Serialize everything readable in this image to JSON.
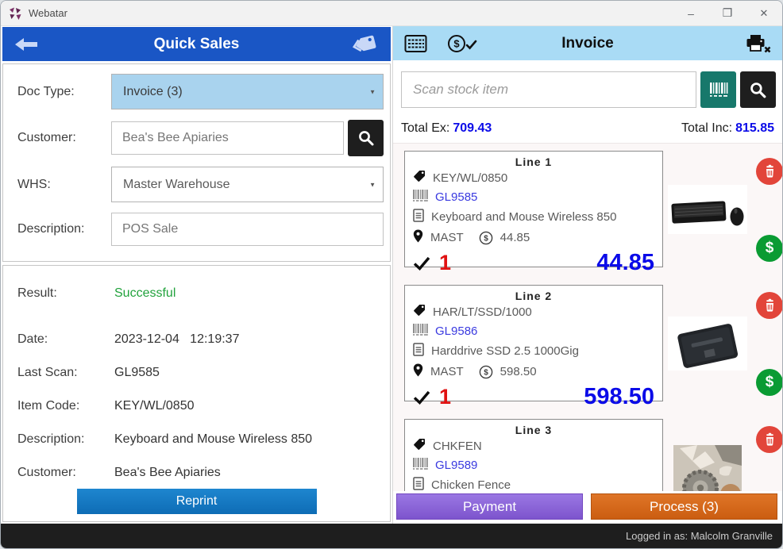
{
  "window": {
    "title": "Webatar",
    "controls": {
      "minimize": "–",
      "maximize": "❒",
      "close": "✕"
    }
  },
  "left_panel": {
    "header": {
      "title": "Quick Sales"
    },
    "form": {
      "doc_type": {
        "label": "Doc Type:",
        "value": "Invoice (3)"
      },
      "customer": {
        "label": "Customer:",
        "value": "Bea's Bee Apiaries"
      },
      "whs": {
        "label": "WHS:",
        "value": "Master Warehouse"
      },
      "description": {
        "label": "Description:",
        "value": "POS Sale"
      }
    },
    "result": {
      "rows": [
        {
          "label": "Result:",
          "value": "Successful"
        },
        {
          "label": "Date:",
          "value": "2023-12-04   12:19:37"
        },
        {
          "label": "Last Scan:",
          "value": "GL9585"
        },
        {
          "label": "Item Code:",
          "value": "KEY/WL/0850"
        },
        {
          "label": "Description:",
          "value": "Keyboard and Mouse Wireless 850"
        },
        {
          "label": "Customer:",
          "value": "Bea's Bee Apiaries"
        }
      ],
      "reprint_label": "Reprint"
    }
  },
  "right_panel": {
    "header": {
      "title": "Invoice"
    },
    "scan": {
      "placeholder": "Scan stock item"
    },
    "totals": {
      "ex_label": "Total Ex:",
      "ex_value": "709.43",
      "inc_label": "Total Inc:",
      "inc_value": "815.85"
    },
    "lines": [
      {
        "title": "Line 1",
        "item_code": "KEY/WL/0850",
        "barcode": "GL9585",
        "description": "Keyboard and Mouse Wireless 850",
        "warehouse": "MAST",
        "unit_price": "44.85",
        "qty": "1",
        "total": "44.85"
      },
      {
        "title": "Line 2",
        "item_code": "HAR/LT/SSD/1000",
        "barcode": "GL9586",
        "description": "Harddrive SSD 2.5 1000Gig",
        "warehouse": "MAST",
        "unit_price": "598.50",
        "qty": "1",
        "total": "598.50"
      },
      {
        "title": "Line 3",
        "item_code": "CHKFEN",
        "barcode": "GL9589",
        "description": "Chicken Fence"
      }
    ],
    "actions": {
      "payment_label": "Payment",
      "process_label": "Process (3)"
    }
  },
  "statusbar": {
    "text": "Logged in as: Malcolm Granville"
  },
  "icons": {
    "caret": "▼",
    "dollar": "$"
  },
  "colors": {
    "accent_blue": "#1a56c5",
    "header_light_blue": "#a9dbf5",
    "value_blue": "#0b0be8",
    "qty_red": "#e01212",
    "success_green": "#21a23c",
    "trash_red": "#e2453a",
    "dollar_green": "#0a9b33",
    "payment_purple": "#8a62d4",
    "process_orange": "#d4671c",
    "reprint_blue": "#1478c0",
    "barcode_teal": "#17786b"
  }
}
